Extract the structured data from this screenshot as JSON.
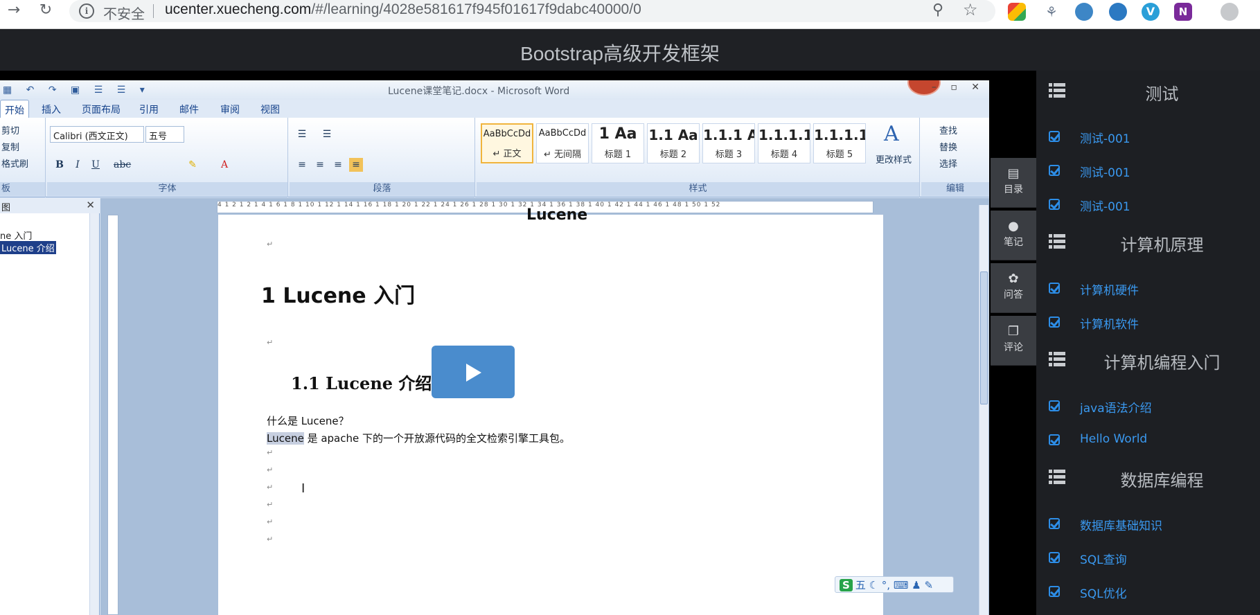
{
  "browser": {
    "security_label": "不安全",
    "url_host": "ucenter.xuecheng.com",
    "url_path": "/#/learning/4028e581617f945f01617f9dabc40000/0"
  },
  "header": {
    "title": "Bootstrap高级开发框架"
  },
  "word": {
    "window_title": "Lucene课堂笔记.docx - Microsoft Word",
    "tabs": [
      "开始",
      "插入",
      "页面布局",
      "引用",
      "邮件",
      "审阅",
      "视图"
    ],
    "clipboard": {
      "cut": "剪切",
      "copy": "复制",
      "painter": "格式刷",
      "group": "板"
    },
    "font": {
      "name": "Calibri (西文正文)",
      "size": "五号",
      "group": "字体"
    },
    "paragraph_group": "段落",
    "styles": {
      "group": "样式",
      "items": [
        {
          "preview": "AaBbCcDd",
          "name": "↵ 正文"
        },
        {
          "preview": "AaBbCcDd",
          "name": "↵ 无间隔"
        },
        {
          "preview": "1 Aa",
          "name": "标题 1"
        },
        {
          "preview": "1.1 Aa",
          "name": "标题 2"
        },
        {
          "preview": "1.1.1 A",
          "name": "标题 3"
        },
        {
          "preview": "1.1.1.1",
          "name": "标题 4"
        },
        {
          "preview": "1.1.1.1.",
          "name": "标题 5"
        }
      ],
      "change": "更改样式"
    },
    "editing": {
      "find": "查找",
      "replace": "替换",
      "select": "选择",
      "group": "编辑"
    },
    "navpane": {
      "title": "图",
      "items": [
        "ne 入门",
        "Lucene 介绍"
      ]
    },
    "ruler_text": "4 1 2 1 2 1 4 1 6 1 8 1 10 1 12 1 14 1 16 1 18 1 20 1 22 1 24 1 26 1 28 1 30 1 32 1 34 1 36 1 38 1 40 1 42 1 44 1 46 1 48 1 50 1 52",
    "doc": {
      "top_heading": "Lucene",
      "heading1": "1  Lucene 入门",
      "heading2": "1.1 Lucene 介绍",
      "para1": "什么是 Lucene？",
      "para2_highlight": "Lucene",
      "para2_rest": " 是 apache 下的一个开放源代码的全文检索引擎工具包。"
    },
    "ime": {
      "brand": "S",
      "mode": "五"
    }
  },
  "side_tabs": [
    {
      "icon": "▤",
      "label": "目录"
    },
    {
      "icon": "●",
      "label": "笔记"
    },
    {
      "icon": "✿",
      "label": "问答"
    },
    {
      "icon": "❐",
      "label": "评论"
    }
  ],
  "chapters": [
    {
      "title": "测试",
      "lessons": [
        "测试-001",
        "测试-001",
        "测试-001"
      ]
    },
    {
      "title": "计算机原理",
      "lessons": [
        "计算机硬件",
        "计算机软件"
      ]
    },
    {
      "title": "计算机编程入门",
      "lessons": [
        "java语法介绍",
        "Hello World"
      ]
    },
    {
      "title": "数据库编程",
      "lessons": [
        "数据库基础知识",
        "SQL查询",
        "SQL优化"
      ]
    }
  ],
  "colors": {
    "accent": "#3a99f0",
    "sidebar_bg": "#1d1f23",
    "play": "#4a8ccd"
  }
}
